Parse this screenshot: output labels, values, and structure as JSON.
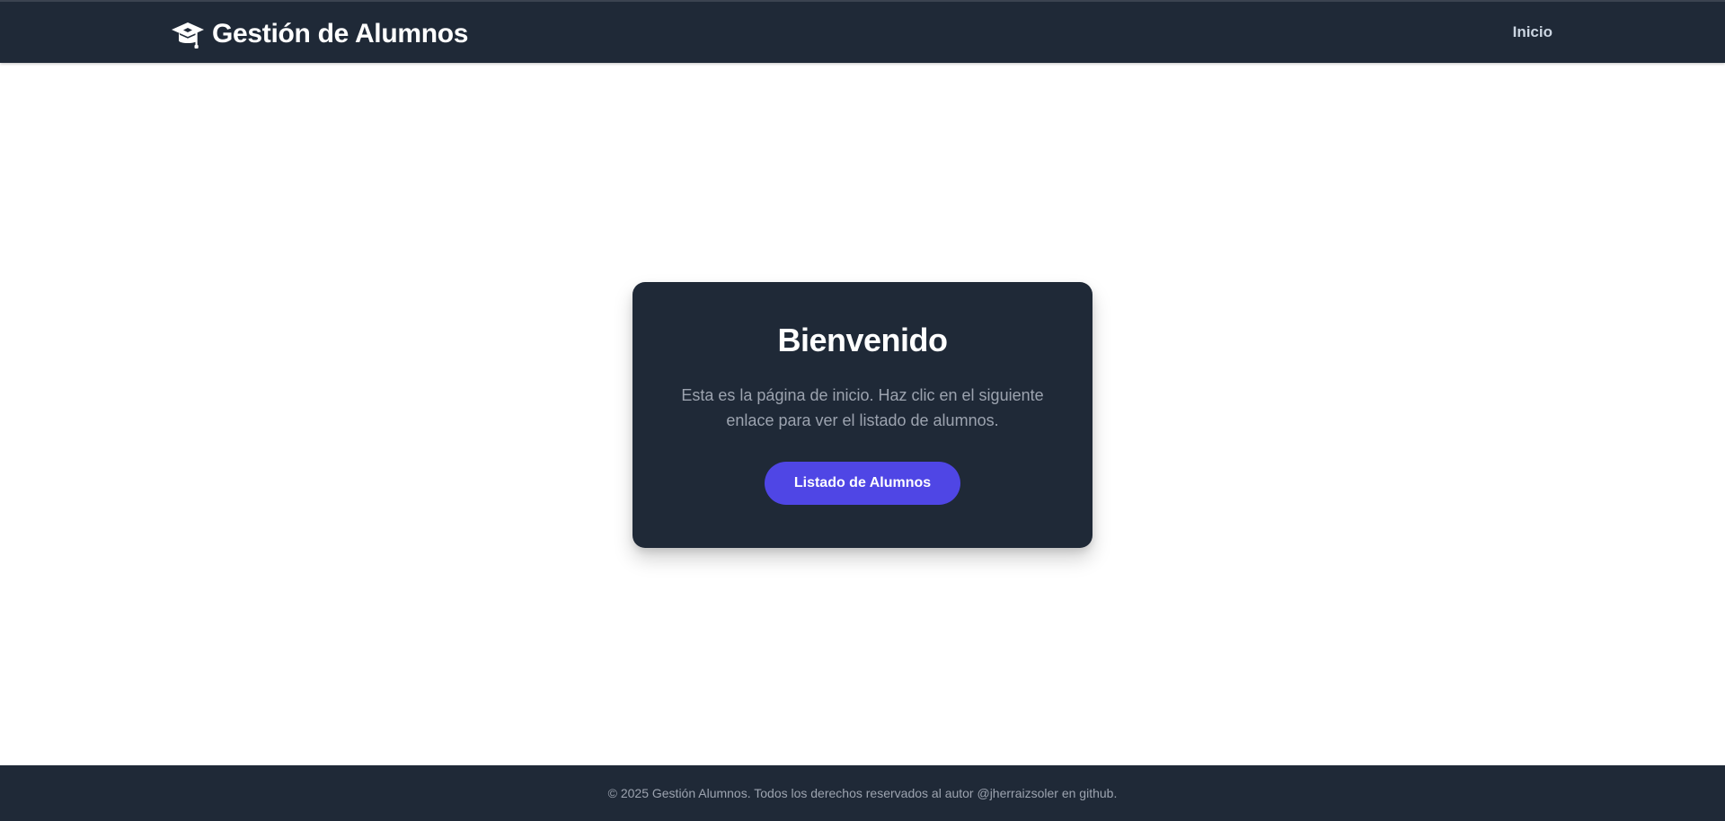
{
  "header": {
    "brand_icon": "graduation-cap-icon",
    "brand_title": "Gestión de Alumnos",
    "nav": [
      {
        "label": "Inicio"
      }
    ]
  },
  "card": {
    "title": "Bienvenido",
    "text": "Esta es la página de inicio. Haz clic en el siguiente enlace para ver el listado de alumnos.",
    "button_label": "Listado de Alumnos"
  },
  "footer": {
    "text": "© 2025 Gestión Alumnos. Todos los derechos reservados al autor @jherraizsoler en github."
  },
  "colors": {
    "header_bg": "#1f2937",
    "card_bg": "#1f2937",
    "accent": "#4f46e5",
    "muted_text": "#9ca3af",
    "nav_text": "#cbd5e1",
    "page_bg": "#ffffff"
  }
}
